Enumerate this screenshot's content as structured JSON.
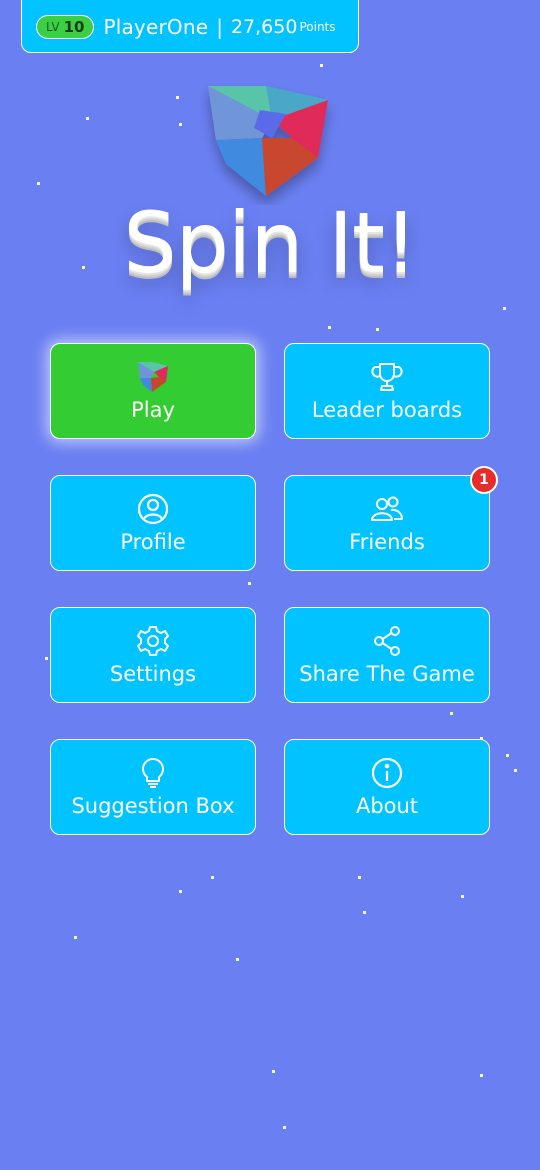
{
  "player": {
    "level_prefix": "LV",
    "level": "10",
    "name": "PlayerOne",
    "separator": "|",
    "points": "27,650",
    "points_label": "Points"
  },
  "title": "Spin It!",
  "menu": {
    "play": "Play",
    "leaderboards": "Leader boards",
    "profile": "Profile",
    "friends": "Friends",
    "friends_badge": "1",
    "settings": "Settings",
    "share": "Share The Game",
    "suggestion": "Suggestion Box",
    "about": "About"
  },
  "colors": {
    "background": "#6a7ff2",
    "button": "#00c3ff",
    "play_button": "#33cc33",
    "badge": "#e82b2b"
  },
  "icons": [
    "cube-logo-icon",
    "trophy-icon",
    "user-circle-icon",
    "friends-icon",
    "gear-icon",
    "share-icon",
    "lightbulb-icon",
    "info-icon"
  ]
}
